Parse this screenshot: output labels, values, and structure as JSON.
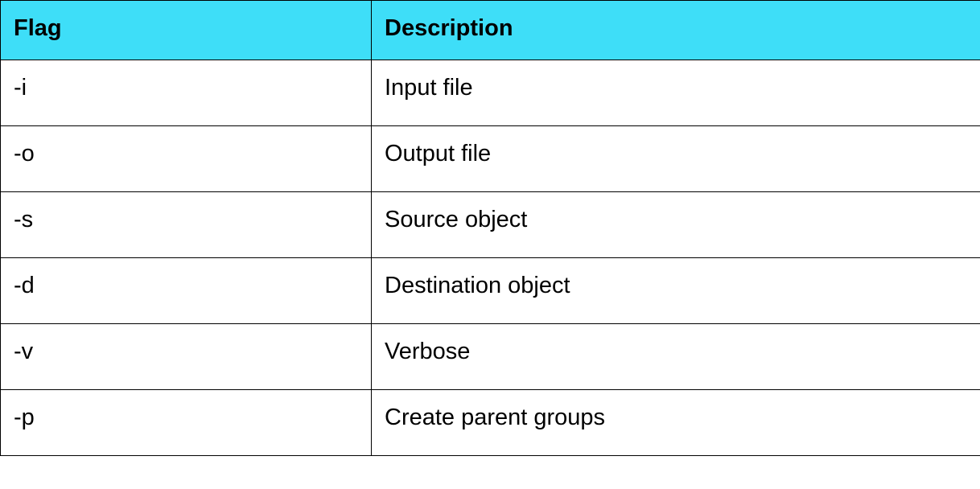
{
  "table": {
    "headers": {
      "flag": "Flag",
      "description": "Description"
    },
    "rows": [
      {
        "flag": "-i",
        "description": "Input file"
      },
      {
        "flag": "-o",
        "description": "Output file"
      },
      {
        "flag": "-s",
        "description": "Source object"
      },
      {
        "flag": "-d",
        "description": "Destination object"
      },
      {
        "flag": "-v",
        "description": "Verbose"
      },
      {
        "flag": "-p",
        "description": "Create parent groups"
      }
    ]
  }
}
